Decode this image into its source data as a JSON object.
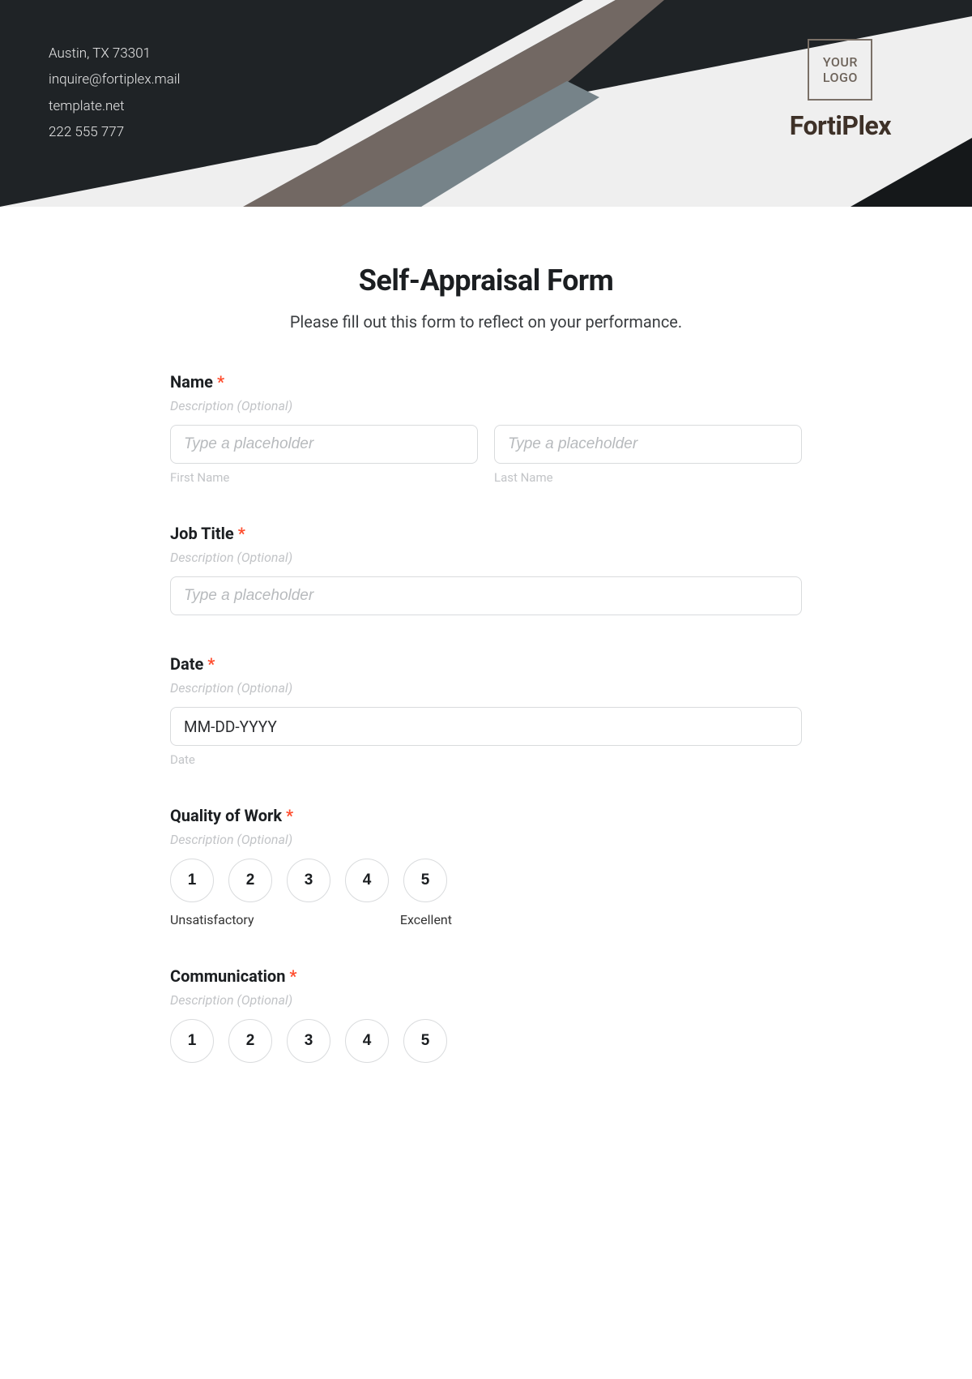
{
  "header": {
    "address": "Austin, TX 73301",
    "email": "inquire@fortiplex.mail",
    "website": "template.net",
    "phone": "222 555 777",
    "logo_text": "YOUR\nLOGO",
    "brand": "FortiPlex"
  },
  "form": {
    "title": "Self-Appraisal Form",
    "subtitle": "Please fill out this form to reflect on your performance.",
    "name": {
      "label": "Name",
      "required": "*",
      "description": "Description (Optional)",
      "first_placeholder": "Type a placeholder",
      "last_placeholder": "Type a placeholder",
      "first_caption": "First Name",
      "last_caption": "Last Name"
    },
    "job_title": {
      "label": "Job Title",
      "required": "*",
      "description": "Description (Optional)",
      "placeholder": "Type a placeholder"
    },
    "date": {
      "label": "Date",
      "required": "*",
      "description": "Description (Optional)",
      "value": "MM-DD-YYYY",
      "caption": "Date"
    },
    "quality": {
      "label": "Quality of Work",
      "required": "*",
      "description": "Description (Optional)",
      "options": [
        "1",
        "2",
        "3",
        "4",
        "5"
      ],
      "low_caption": "Unsatisfactory",
      "high_caption": "Excellent"
    },
    "communication": {
      "label": "Communication",
      "required": "*",
      "description": "Description (Optional)",
      "options": [
        "1",
        "2",
        "3",
        "4",
        "5"
      ]
    }
  }
}
